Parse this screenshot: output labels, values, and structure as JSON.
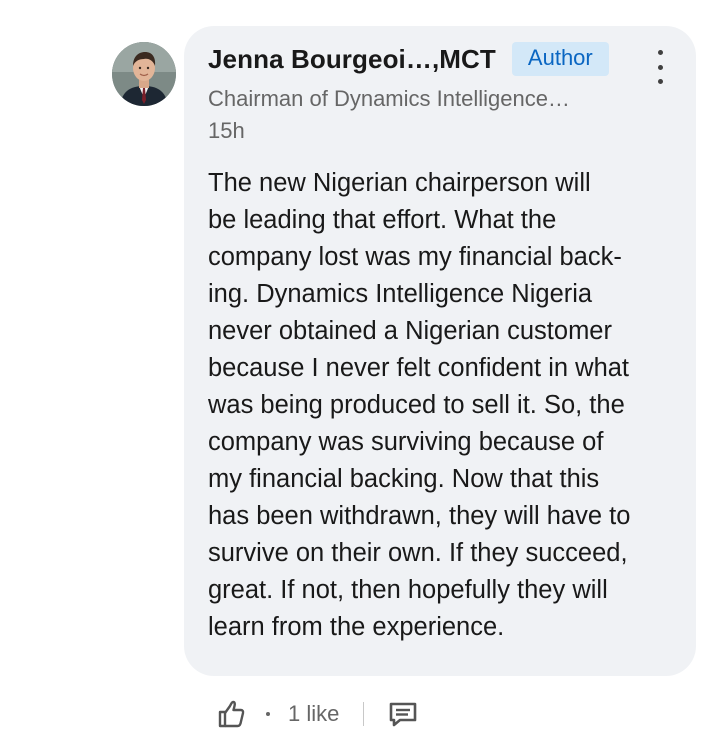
{
  "comment": {
    "author_name": "Jenna Bourgeoi…,MCT",
    "author_badge": "Author",
    "headline": "Chairman of Dynamics Intelligence…",
    "timestamp": "15h",
    "body_lines": [
      "The new Nigerian chairperson will",
      "be leading that effort.  What the",
      "company lost was my financial back-",
      "ing.  Dynamics Intelligence Nigeria",
      "never obtained a Nigerian customer",
      "because I never felt confident in what",
      "was being produced to sell it.  So, the",
      "company was surviving because of",
      "my financial backing.  Now that this",
      "has been withdrawn, they will have to",
      "survive on their own.  If they succeed,",
      "great.  If not, then hopefully they will",
      "learn from the experience."
    ]
  },
  "actions": {
    "like_icon": "thumbs-up-icon",
    "like_count": "1 like",
    "reply_icon": "comment-icon"
  },
  "menu": {
    "icon": "vertical-ellipsis-icon"
  },
  "colors": {
    "bubble_bg": "#f0f2f5",
    "badge_bg": "#d3e8f8",
    "badge_text": "#0a66c2",
    "muted_text": "#666666",
    "primary_text": "#191919"
  }
}
